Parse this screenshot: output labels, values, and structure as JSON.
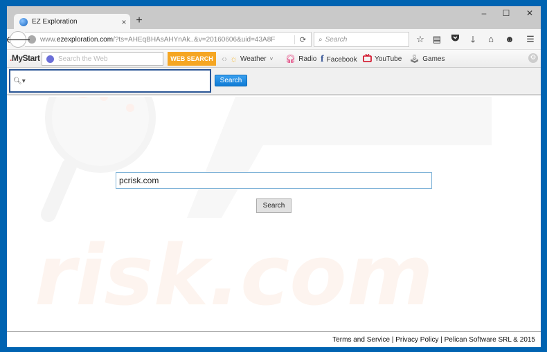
{
  "browser": {
    "tab_title": "EZ Exploration",
    "tab_close": "×",
    "new_tab": "+",
    "window_controls": {
      "minimize": "–",
      "maximize": "☐",
      "close": "✕"
    },
    "url_prefix": "www.",
    "url_domain": "ezexploration.com",
    "url_rest": "/?ts=AHEqBHAsAHYnAk..&v=20160606&uid=43A8F",
    "search_placeholder": "Search",
    "icons": [
      "back-icon",
      "globe-icon",
      "reload-icon",
      "search-icon",
      "bookmark-star-icon",
      "reading-list-icon",
      "pocket-icon",
      "download-icon",
      "home-icon",
      "hello-icon",
      "menu-icon"
    ]
  },
  "mystart": {
    "logo": "MyStart",
    "search_placeholder": "Search the Web",
    "web_search_button": "WEB SEARCH",
    "links": [
      {
        "label": "Weather",
        "icon": "sun-icon"
      },
      {
        "label": "Radio",
        "icon": "headphones-icon"
      },
      {
        "label": "Facebook",
        "icon": "facebook-icon"
      },
      {
        "label": "YouTube",
        "icon": "tv-icon"
      },
      {
        "label": "Games",
        "icon": "joystick-icon"
      }
    ]
  },
  "secondary_search": {
    "value": "",
    "button": "Search"
  },
  "main": {
    "search_value": "pcrisk.com",
    "search_button": "Search"
  },
  "footer": {
    "terms": "Terms and Service",
    "sep": " | ",
    "privacy": "Privacy Policy",
    "copyright": "Pelican Software SRL & 2015"
  },
  "colors": {
    "window_frame": "#0063b1",
    "web_search_orange": "#f5a623",
    "search_button_blue": "#1a88e0",
    "secondary_input_border": "#2a5595"
  }
}
